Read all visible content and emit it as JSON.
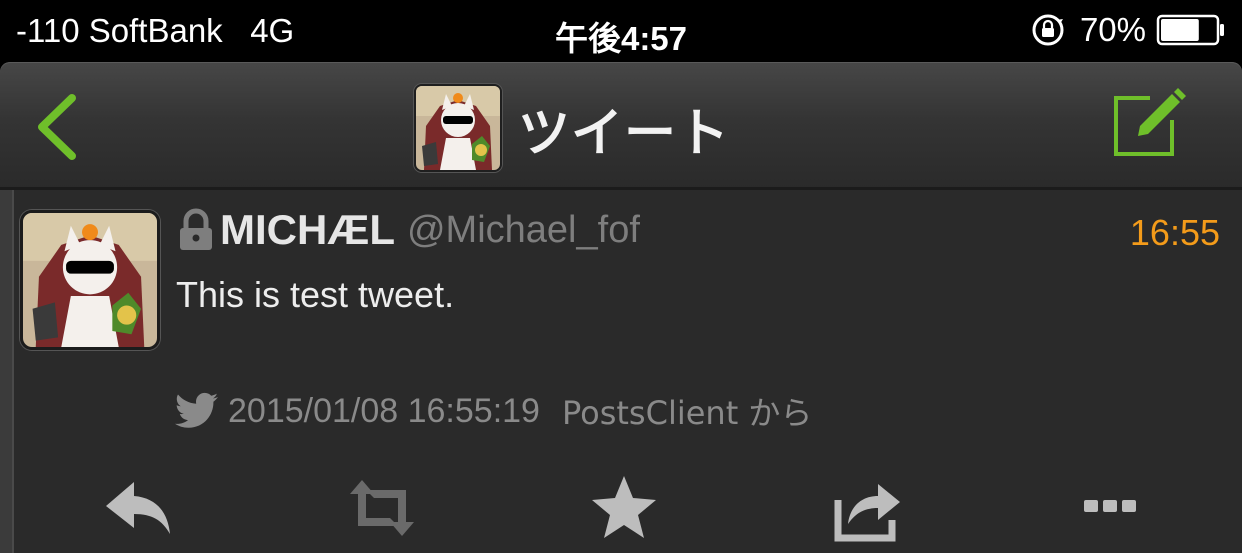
{
  "status_bar": {
    "carrier": "-110 SoftBank   4G",
    "time": "午後4:57",
    "battery_percent": "70%",
    "battery_level": 0.7,
    "icons": [
      "orientation-lock-icon",
      "battery-icon"
    ]
  },
  "nav": {
    "title": "ツイート",
    "back_icon": "chevron-left-icon",
    "compose_icon": "compose-icon",
    "accent_color": "#6fbf2a"
  },
  "tweet": {
    "name": "MICHÆL",
    "handle": "@Michael_fof",
    "time": "16:55",
    "text": "This is test tweet.",
    "protected_icon": "lock-icon",
    "timestamp": "2015/01/08 16:55:19",
    "source": "PostsClient から",
    "time_color": "#f39b1a"
  },
  "actions": [
    {
      "name": "reply-icon"
    },
    {
      "name": "retweet-icon"
    },
    {
      "name": "favorite-icon"
    },
    {
      "name": "share-icon"
    },
    {
      "name": "more-icon"
    }
  ]
}
